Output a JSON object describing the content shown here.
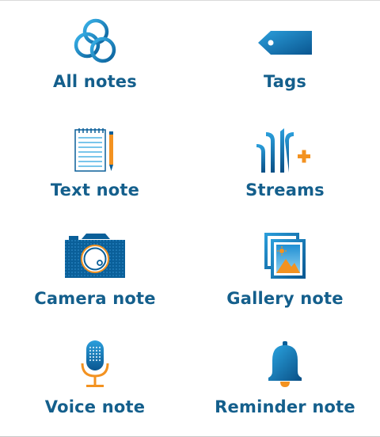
{
  "menu": {
    "items": [
      {
        "label": "All notes",
        "icon": "rings-icon"
      },
      {
        "label": "Tags",
        "icon": "tag-icon"
      },
      {
        "label": "Text note",
        "icon": "notepad-icon"
      },
      {
        "label": "Streams",
        "icon": "streams-icon"
      },
      {
        "label": "Camera note",
        "icon": "camera-icon"
      },
      {
        "label": "Gallery note",
        "icon": "gallery-icon"
      },
      {
        "label": "Voice note",
        "icon": "microphone-icon"
      },
      {
        "label": "Reminder note",
        "icon": "bell-icon"
      }
    ]
  },
  "colors": {
    "label": "#145f8c",
    "primary_blue": "#0a5f99",
    "light_blue": "#29a3df",
    "accent_orange": "#f39220",
    "border": "#d9d9d9"
  }
}
